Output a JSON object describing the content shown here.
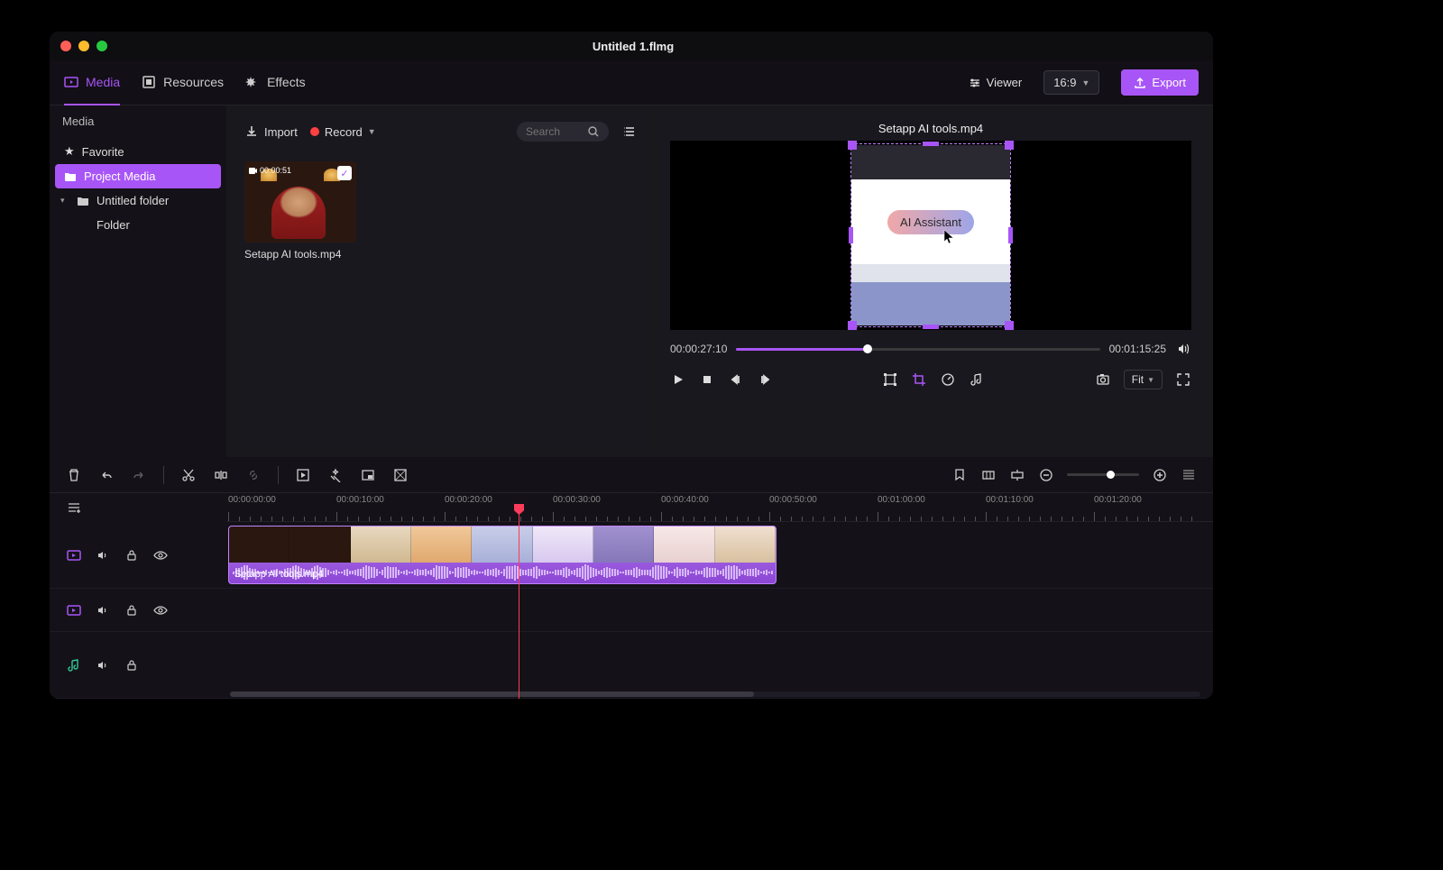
{
  "window": {
    "title": "Untitled 1.flmg"
  },
  "tabs": {
    "media": "Media",
    "resources": "Resources",
    "effects": "Effects"
  },
  "topbar": {
    "viewer": "Viewer",
    "aspect": "16:9",
    "export": "Export"
  },
  "sidebar": {
    "heading": "Media",
    "favorite": "Favorite",
    "project_media": "Project Media",
    "untitled_folder": "Untitled folder",
    "folder": "Folder"
  },
  "browser": {
    "import": "Import",
    "record": "Record",
    "search_placeholder": "Search",
    "clip": {
      "duration": "00:00:51",
      "name": "Setapp AI tools.mp4"
    }
  },
  "preview": {
    "title": "Setapp AI tools.mp4",
    "ai_label": "AI Assistant",
    "current_time": "00:00:27:10",
    "total_time": "00:01:15:25",
    "fit": "Fit"
  },
  "timeline": {
    "marks": [
      "00:00:00:00",
      "00:00:10:00",
      "00:00:20:00",
      "00:00:30:00",
      "00:00:40:00",
      "00:00:50:00",
      "00:01:00:00",
      "00:01:10:00",
      "00:01:20:00"
    ],
    "clip_label": "Setapp AI tools.mp4"
  }
}
